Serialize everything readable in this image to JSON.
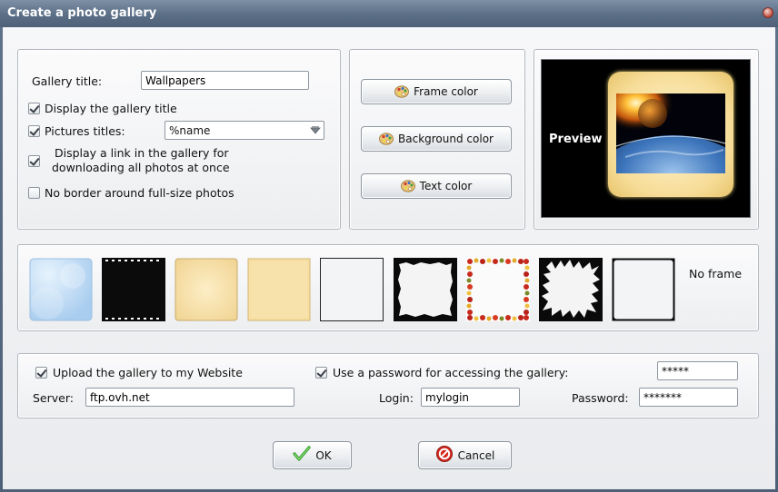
{
  "window": {
    "title": "Create a photo gallery"
  },
  "options": {
    "gallery_title_label": "Gallery title:",
    "gallery_title_value": "Wallpapers",
    "display_title": {
      "label": "Display the gallery title",
      "checked": true
    },
    "pictures_titles": {
      "label": "Pictures titles:",
      "checked": true,
      "selected": "%name"
    },
    "download_link": {
      "line1": "Display a link in the gallery for",
      "line2": "downloading all photos at once",
      "checked": true
    },
    "no_border": {
      "label": "No border around full-size photos",
      "checked": false
    }
  },
  "colors": {
    "frame_color": "Frame color",
    "background_color": "Background color",
    "text_color": "Text color"
  },
  "preview": {
    "label": "Preview"
  },
  "frames": {
    "no_frame_label": "No frame",
    "accent_cream": "#f7dea2",
    "accent_blue": "#bcdcf5"
  },
  "upload": {
    "upload_label": "Upload the gallery to my Website",
    "upload_checked": true,
    "password_access_label": "Use a password for accessing the gallery:",
    "password_access_checked": true,
    "access_password_value": "*****",
    "server_label": "Server:",
    "server_value": "ftp.ovh.net",
    "login_label": "Login:",
    "login_value": "mylogin",
    "password_label": "Password:",
    "password_value": "*******"
  },
  "footer": {
    "ok_label": "OK",
    "cancel_label": "Cancel"
  }
}
